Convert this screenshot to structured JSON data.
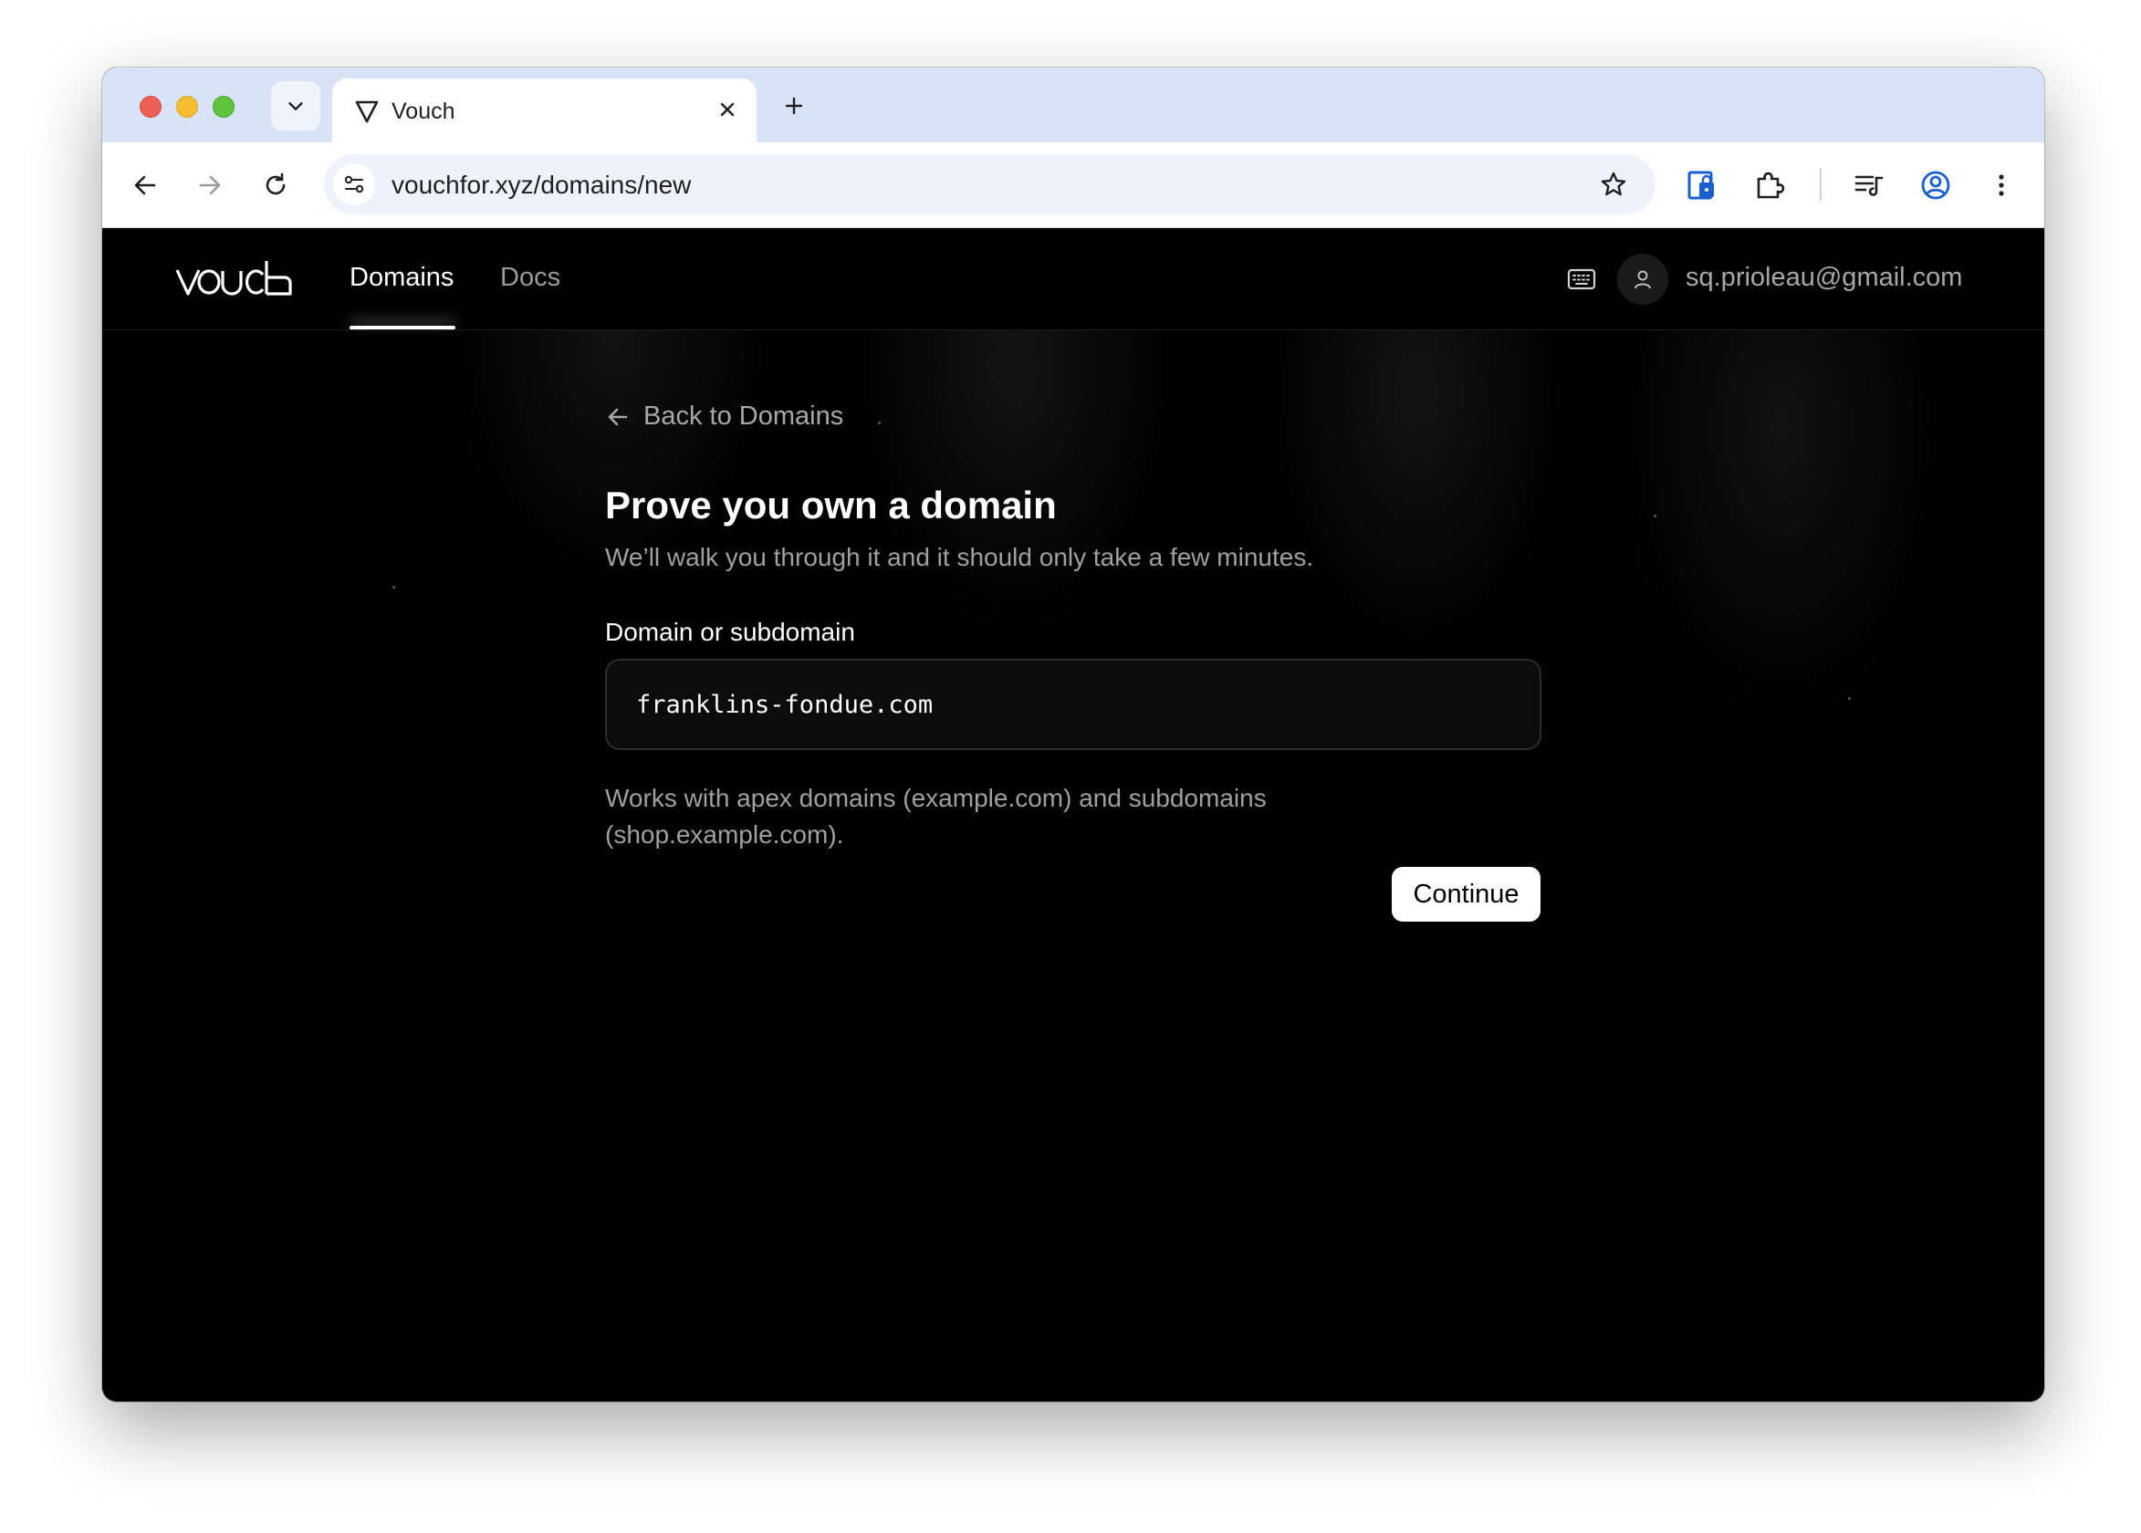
{
  "browser": {
    "tab": {
      "title": "Vouch",
      "favicon": "triangle-icon"
    },
    "url": "vouchfor.xyz/domains/new",
    "accent_color": "#d8e3f7"
  },
  "app": {
    "nav": {
      "links": [
        {
          "label": "Domains",
          "active": true
        },
        {
          "label": "Docs",
          "active": false
        }
      ]
    },
    "user": {
      "email": "sq.prioleau@gmail.com"
    }
  },
  "form": {
    "back_label": "Back to Domains",
    "title": "Prove you own a domain",
    "subtitle": "We’ll walk you through it and it should only take a few minutes.",
    "field_label": "Domain or subdomain",
    "field_value": "franklins-fondue.com",
    "helper": "Works with apex domains (example.com) and subdomains (shop.example.com).",
    "submit_label": "Continue"
  }
}
